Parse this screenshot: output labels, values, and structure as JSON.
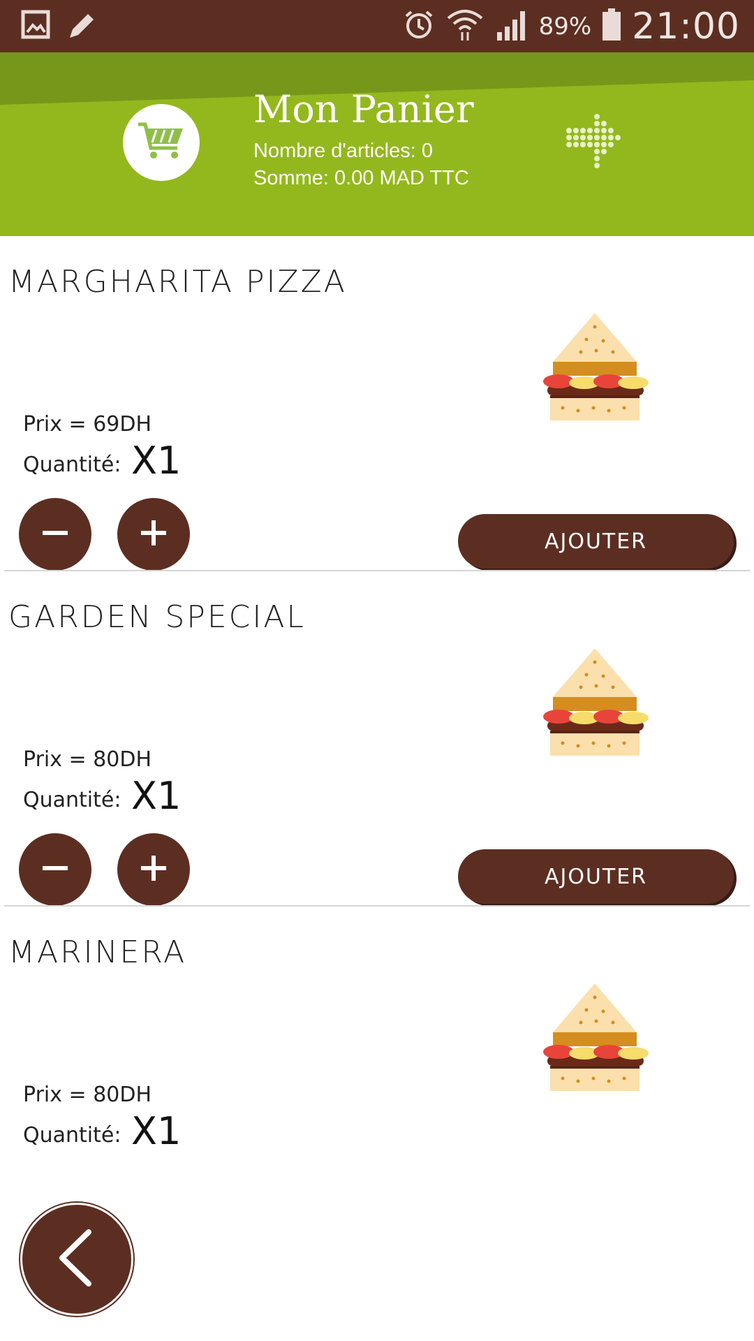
{
  "status_bar": {
    "battery_percent": "89%",
    "time": "21:00"
  },
  "header": {
    "title": "Mon Panier",
    "items_count_text": "Nombre d'articles: 0",
    "total_text": "Somme: 0.00 MAD TTC"
  },
  "products": [
    {
      "name": "MARGHARITA PIZZA",
      "price_text": "Prix = 69DH",
      "quantity_label": "Quantité:",
      "quantity_value": "X1",
      "add_label": "AJOUTER"
    },
    {
      "name": "GARDEN SPECIAL",
      "price_text": "Prix = 80DH",
      "quantity_label": "Quantité:",
      "quantity_value": "X1",
      "add_label": "AJOUTER"
    },
    {
      "name": "MARINERA",
      "price_text": "Prix = 80DH",
      "quantity_label": "Quantité:",
      "quantity_value": "X1"
    }
  ],
  "colors": {
    "primary_brown": "#5c2e22",
    "header_green": "#93b81d",
    "header_band_green": "#6f8f1a"
  },
  "icons": {
    "status_left": [
      "image-icon",
      "pencil-icon"
    ],
    "status_right": [
      "alarm-icon",
      "wifi-icon",
      "signal-icon",
      "battery-icon"
    ],
    "header": [
      "cart-icon",
      "dotted-arrow-icon"
    ],
    "controls": [
      "minus-icon",
      "plus-icon",
      "chevron-left-icon"
    ],
    "product_image": "sandwich-icon"
  }
}
